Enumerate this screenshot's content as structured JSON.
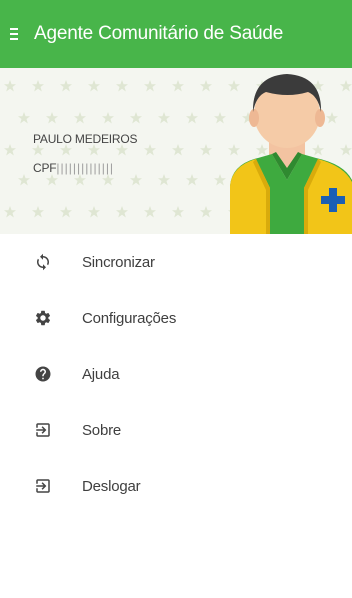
{
  "appbar": {
    "title": "Agente Comunitário de Saúde",
    "menu_icon": "hamburger-menu-icon"
  },
  "header": {
    "user_name": "PAULO MEDEIROS",
    "cpf_label": "CPF",
    "cpf_value": "||||||||||||||",
    "avatar_icon": "health-agent-avatar"
  },
  "menu": {
    "items": [
      {
        "label": "Sincronizar",
        "icon": "sync-icon"
      },
      {
        "label": "Configurações",
        "icon": "gear-icon"
      },
      {
        "label": "Ajuda",
        "icon": "help-icon"
      },
      {
        "label": "Sobre",
        "icon": "exit-to-app-icon"
      },
      {
        "label": "Deslogar",
        "icon": "exit-to-app-icon"
      }
    ]
  },
  "colors": {
    "appbar": "#48b54a",
    "header_bg": "#f4f6f0",
    "text": "#3f3f3f",
    "icon": "#444444"
  }
}
